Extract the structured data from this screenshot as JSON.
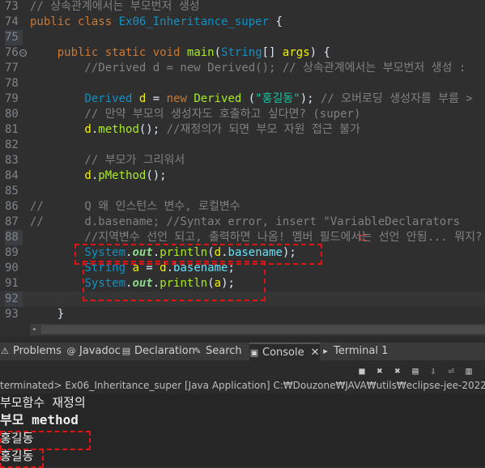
{
  "editor": {
    "lines": [
      {
        "num": "73",
        "tokens": [
          {
            "t": "// 상속관계에서는 부모번저 생성",
            "c": "cm"
          }
        ]
      },
      {
        "num": "74",
        "tokens": [
          {
            "t": "public ",
            "c": "kw"
          },
          {
            "t": "class ",
            "c": "kw"
          },
          {
            "t": "Ex06_Inheritance_super",
            "c": "cls"
          },
          {
            "t": " {",
            "c": "plain"
          }
        ]
      },
      {
        "num": "75",
        "tokens": [],
        "hlnum": true
      },
      {
        "num": "76",
        "fold": true,
        "tokens": [
          {
            "t": "    public ",
            "c": "kw"
          },
          {
            "t": "static ",
            "c": "kw"
          },
          {
            "t": "void ",
            "c": "kw"
          },
          {
            "t": "main",
            "c": "fn"
          },
          {
            "t": "(",
            "c": "plain"
          },
          {
            "t": "String",
            "c": "cls"
          },
          {
            "t": "[] ",
            "c": "plain"
          },
          {
            "t": "args",
            "c": "var"
          },
          {
            "t": ") {",
            "c": "plain"
          }
        ]
      },
      {
        "num": "77",
        "tokens": [
          {
            "t": "        //Derived d = new Derived(); // 상속관계에서는 부모번저 생성 :",
            "c": "cm"
          }
        ]
      },
      {
        "num": "78",
        "tokens": []
      },
      {
        "num": "79",
        "tokens": [
          {
            "t": "        Derived ",
            "c": "cls"
          },
          {
            "t": "d",
            "c": "var"
          },
          {
            "t": " = ",
            "c": "plain"
          },
          {
            "t": "new ",
            "c": "kw"
          },
          {
            "t": "Derived ",
            "c": "fn"
          },
          {
            "t": "(",
            "c": "plain"
          },
          {
            "t": "\"홍길동\"",
            "c": "str"
          },
          {
            "t": "); ",
            "c": "plain"
          },
          {
            "t": "// 오버로딩 생성자를 부름 >",
            "c": "cm"
          }
        ]
      },
      {
        "num": "80",
        "tokens": [
          {
            "t": "        // 만약 부모의 생성자도 호출하고 싶다면? (super)",
            "c": "cm"
          }
        ]
      },
      {
        "num": "81",
        "tokens": [
          {
            "t": "        d",
            "c": "var"
          },
          {
            "t": ".",
            "c": "plain"
          },
          {
            "t": "method",
            "c": "fn"
          },
          {
            "t": "(); ",
            "c": "plain"
          },
          {
            "t": "//재정의가 되면 부모 자원 접근 불가",
            "c": "cm"
          }
        ]
      },
      {
        "num": "82",
        "tokens": []
      },
      {
        "num": "83",
        "tokens": [
          {
            "t": "        // 부모가 그리워서",
            "c": "cm"
          }
        ]
      },
      {
        "num": "84",
        "tokens": [
          {
            "t": "        d",
            "c": "var"
          },
          {
            "t": ".",
            "c": "plain"
          },
          {
            "t": "pMethod",
            "c": "fn"
          },
          {
            "t": "();",
            "c": "plain"
          }
        ]
      },
      {
        "num": "85",
        "tokens": []
      },
      {
        "num": "86",
        "tokens": [
          {
            "t": "//      Q 왜 인스턴스 변수, 로컬변수",
            "c": "cm"
          }
        ]
      },
      {
        "num": "87",
        "tokens": [
          {
            "t": "//      d.basename; //Syntax error, insert \"VariableDeclarators",
            "c": "cm"
          }
        ]
      },
      {
        "num": "88",
        "hlnum": true,
        "tokens": [
          {
            "t": "        //지역변수 선언 되고, 출력하면 나옴! 멤버 필드에서는 선언 안됨... 뭐지?",
            "c": "cm"
          }
        ]
      },
      {
        "num": "89",
        "tokens": [
          {
            "t": "        System",
            "c": "cls"
          },
          {
            "t": ".",
            "c": "plain"
          },
          {
            "t": "out",
            "c": "sfield"
          },
          {
            "t": ".",
            "c": "plain"
          },
          {
            "t": "println",
            "c": "fn"
          },
          {
            "t": "(",
            "c": "plain"
          },
          {
            "t": "d",
            "c": "var"
          },
          {
            "t": ".",
            "c": "plain"
          },
          {
            "t": "basename",
            "c": "field"
          },
          {
            "t": ");",
            "c": "plain"
          }
        ]
      },
      {
        "num": "90",
        "tokens": [
          {
            "t": "        String ",
            "c": "cls"
          },
          {
            "t": "a",
            "c": "var"
          },
          {
            "t": " = ",
            "c": "plain"
          },
          {
            "t": "d",
            "c": "var"
          },
          {
            "t": ".",
            "c": "plain"
          },
          {
            "t": "basename",
            "c": "field"
          },
          {
            "t": ";",
            "c": "plain"
          }
        ]
      },
      {
        "num": "91",
        "tokens": [
          {
            "t": "        System",
            "c": "cls"
          },
          {
            "t": ".",
            "c": "plain"
          },
          {
            "t": "out",
            "c": "sfield"
          },
          {
            "t": ".",
            "c": "plain"
          },
          {
            "t": "println",
            "c": "fn"
          },
          {
            "t": "(",
            "c": "plain"
          },
          {
            "t": "a",
            "c": "var"
          },
          {
            "t": ");",
            "c": "plain"
          }
        ]
      },
      {
        "num": "92",
        "tokens": [],
        "current": true,
        "hlnum": true
      },
      {
        "num": "93",
        "tokens": [
          {
            "t": "    }",
            "c": "plain"
          }
        ]
      }
    ],
    "red_mark": "ㄷ"
  },
  "tabs": [
    {
      "label": "Problems",
      "icon": "problems-icon",
      "glyph": "⚠"
    },
    {
      "label": "Javadoc",
      "icon": "javadoc-icon",
      "glyph": "@"
    },
    {
      "label": "Declaration",
      "icon": "declaration-icon",
      "glyph": "▤"
    },
    {
      "label": "Search",
      "icon": "search-icon",
      "glyph": "✎"
    },
    {
      "label": "Console",
      "icon": "console-icon",
      "glyph": "▣",
      "active": true,
      "close": "✕"
    },
    {
      "label": "Terminal 1",
      "icon": "terminal-icon",
      "glyph": "▸"
    }
  ],
  "toolbar": [
    {
      "name": "stop-icon",
      "glyph": "■"
    },
    {
      "name": "remove-launch-icon",
      "glyph": "✖"
    },
    {
      "name": "remove-all-icon",
      "glyph": "✖"
    },
    {
      "name": "clear-console-icon",
      "glyph": "▤"
    },
    {
      "name": "scroll-lock-icon",
      "glyph": "⇩"
    },
    {
      "name": "word-wrap-icon",
      "glyph": "⏎"
    },
    {
      "name": "pin-console-icon",
      "glyph": "▥"
    }
  ],
  "status": "terminated> Ex06_Inheritance_super [Java Application] C:₩Douzone₩JAVA₩utils₩eclipse-jee-2022-12-R-win32",
  "console_output": [
    "부모함수 재정의",
    "부모 method",
    "홍길동",
    "홍길동"
  ],
  "colors": {
    "annotation_red": "#e01414",
    "editor_bg": "#2f2f2f"
  }
}
